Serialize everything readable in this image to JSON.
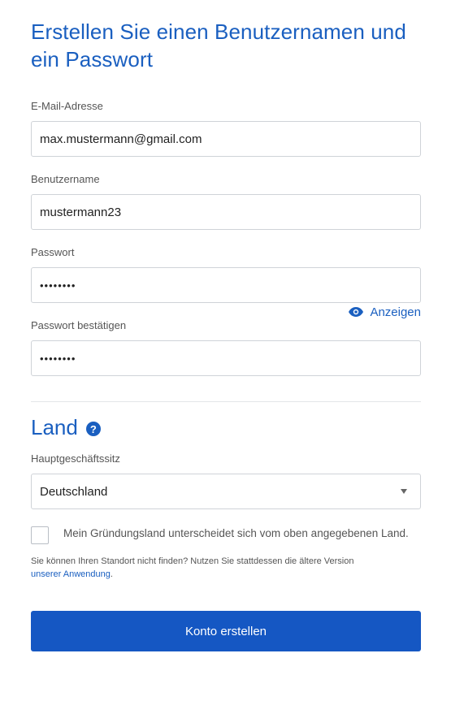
{
  "form": {
    "title": "Erstellen Sie einen Benutzernamen und ein Passwort",
    "email_label": "E-Mail-Adresse",
    "email_value": "max.mustermann@gmail.com",
    "username_label": "Benutzername",
    "username_value": "mustermann23",
    "password_label": "Passwort",
    "password_value": "••••••••",
    "show_password_label": "Anzeigen",
    "confirm_label": "Passwort bestätigen",
    "confirm_value": "••••••••"
  },
  "country": {
    "title": "Land",
    "help_glyph": "?",
    "hq_label": "Hauptgeschäftssitz",
    "selected": "Deutschland",
    "checkbox_label": "Mein Gründungsland unterscheidet sich vom oben angegebenen Land.",
    "checkbox_checked": false,
    "hint_text": "Sie können Ihren Standort nicht finden? Nutzen Sie stattdessen die ältere Version",
    "hint_link": "unserer Anwendung",
    "hint_end": "."
  },
  "submit": {
    "label": "Konto erstellen"
  },
  "colors": {
    "accent": "#1a5fc0",
    "button": "#1557c3",
    "border": "#cfd3d8"
  },
  "icons": {
    "show_password": "eye-icon",
    "help": "question-circle-icon",
    "select": "caret-down-icon"
  }
}
